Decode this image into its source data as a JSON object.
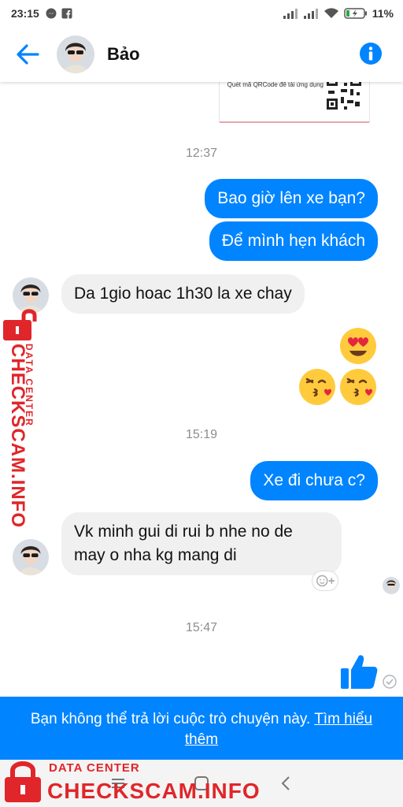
{
  "status_bar": {
    "time": "23:15",
    "battery": "11%",
    "icons": [
      "messenger-icon",
      "facebook-icon",
      "signal-icon",
      "signal-icon",
      "wifi-icon",
      "battery-charging-icon"
    ]
  },
  "header": {
    "contact_name": "Bảo",
    "back_icon": "arrow-left-icon",
    "info_icon": "info-icon"
  },
  "chat": {
    "qr_card": {
      "text": "Quét mã QRCode để tải ứng dụng"
    },
    "messages": [
      {
        "type": "timestamp",
        "text": "12:37"
      },
      {
        "type": "outgoing",
        "text": "Bao giờ lên xe bạn?"
      },
      {
        "type": "outgoing",
        "text": "Để mình hẹn khách"
      },
      {
        "type": "incoming",
        "text": "Da 1gio hoac 1h30 la xe chay"
      },
      {
        "type": "emoji",
        "names": [
          "heart-eyes-emoji",
          "kissing-heart-emoji",
          "kissing-heart-emoji"
        ]
      },
      {
        "type": "timestamp",
        "text": "15:19"
      },
      {
        "type": "outgoing",
        "text": "Xe đi chưa c?"
      },
      {
        "type": "incoming",
        "line1": "Vk minh gui di rui b nhe no de",
        "line2": "may o nha kg mang di"
      },
      {
        "type": "timestamp",
        "text": "15:47"
      },
      {
        "type": "like",
        "icon": "thumbs-up-icon"
      }
    ]
  },
  "banner": {
    "text": "Bạn không thể trả lời cuộc trò chuyện này. ",
    "link": "Tìm hiểu thêm"
  },
  "watermark": {
    "small": "DATA CENTER",
    "big": "CHECKSCAM.INFO"
  },
  "colors": {
    "accent": "#0084ff",
    "incoming_bubble": "#f1f0f0",
    "watermark": "#e0262a"
  }
}
